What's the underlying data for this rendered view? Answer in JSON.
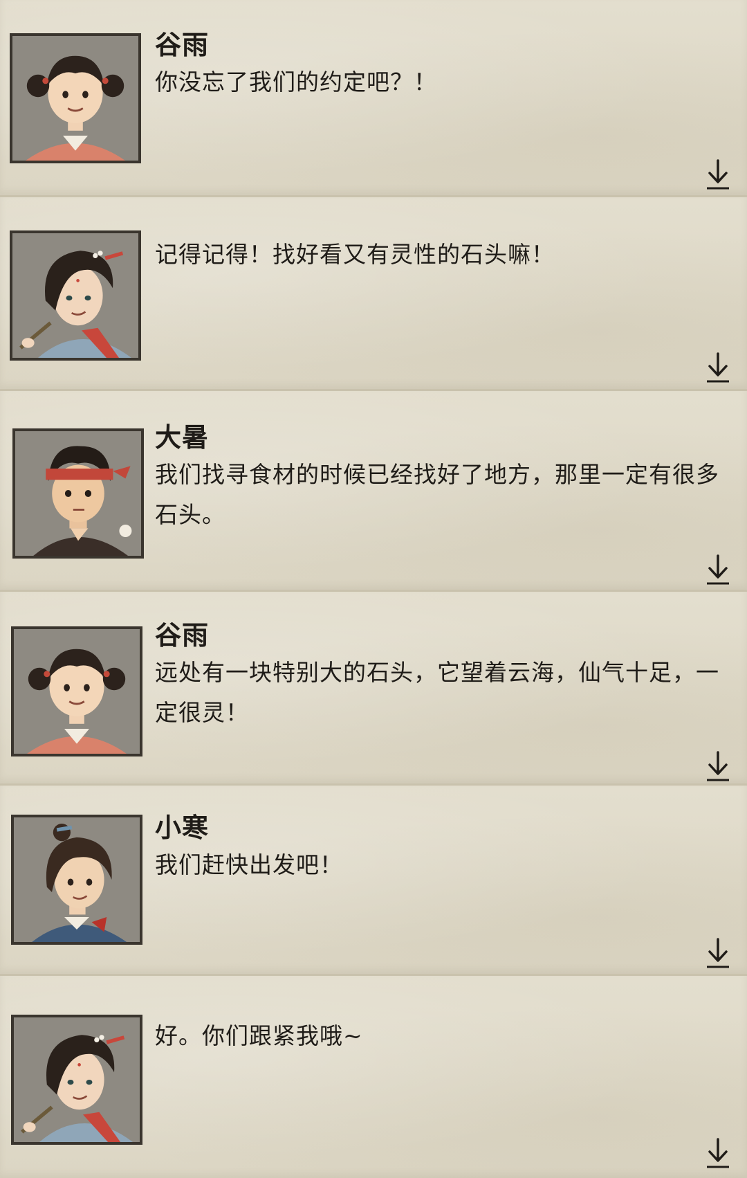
{
  "dialogue": [
    {
      "speaker": "谷雨",
      "character": "guyu",
      "text": "你没忘了我们的约定吧？！"
    },
    {
      "speaker": "",
      "character": "elder-sister",
      "text": "记得记得！找好看又有灵性的石头嘛！"
    },
    {
      "speaker": "大暑",
      "character": "dashu",
      "text": "我们找寻食材的时候已经找好了地方，那里一定有很多石头。"
    },
    {
      "speaker": "谷雨",
      "character": "guyu",
      "text": "远处有一块特别大的石头，它望着云海，仙气十足，一定很灵！"
    },
    {
      "speaker": "小寒",
      "character": "xiaohan",
      "text": "我们赶快出发吧！"
    },
    {
      "speaker": "",
      "character": "elder-sister",
      "text": "好。你们跟紧我哦~"
    }
  ],
  "icons": {
    "next": "arrow-down-icon"
  },
  "colors": {
    "paper": "#e0dbca",
    "ink": "#1f1c18",
    "frame": "#3a352e"
  }
}
